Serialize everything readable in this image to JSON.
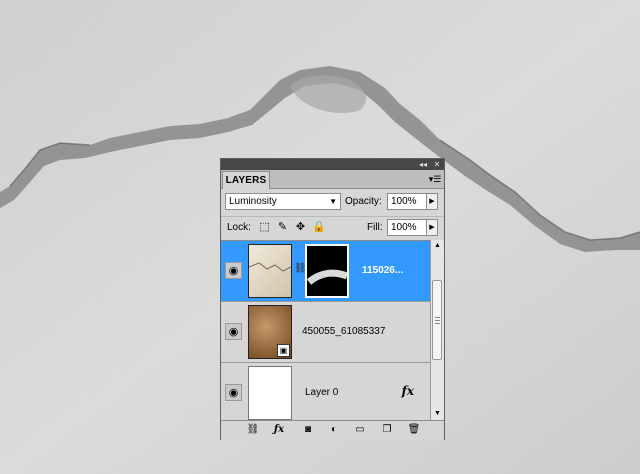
{
  "panel": {
    "tab_label": "LAYERS",
    "blend_mode": "Luminosity",
    "opacity_label": "Opacity:",
    "opacity_value": "100%",
    "lock_label": "Lock:",
    "fill_label": "Fill:",
    "fill_value": "100%"
  },
  "layers": [
    {
      "name": "115026...",
      "selected": true,
      "has_mask": true
    },
    {
      "name": "450055_61085337",
      "selected": false,
      "smart_object": true
    },
    {
      "name": "Layer 0",
      "selected": false,
      "has_fx": true,
      "fx_label": "fx"
    }
  ],
  "icons": {
    "collapse": "double-chevron-icon",
    "close": "close-icon",
    "panel_menu": "panel-menu-icon",
    "eye": "eye-icon",
    "lock_transparent": "lock-transparent-pixels-icon",
    "lock_image": "brush-icon",
    "lock_position": "move-icon",
    "lock_all": "lock-icon",
    "link_layers": "link-icon",
    "add_style": "fx-icon",
    "add_mask": "mask-icon",
    "adjustment": "adjustment-icon",
    "group": "folder-icon",
    "new_layer": "new-layer-icon",
    "delete": "trash-icon"
  },
  "colors": {
    "selection": "#3399ff",
    "panel": "#d6d6d6"
  }
}
